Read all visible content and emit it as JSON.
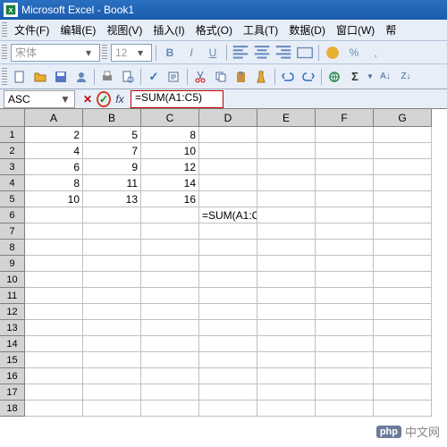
{
  "title": "Microsoft Excel - Book1",
  "menu": {
    "file": "文件(F)",
    "edit": "编辑(E)",
    "view": "视图(V)",
    "insert": "插入(I)",
    "format": "格式(O)",
    "tools": "工具(T)",
    "data": "数据(D)",
    "window": "窗口(W)",
    "help": "帮"
  },
  "format_bar": {
    "font_name": "宋体",
    "font_size": "12"
  },
  "formula_bar": {
    "name_box": "ASC",
    "formula": "=SUM(A1:C5)"
  },
  "columns": [
    "A",
    "B",
    "C",
    "D",
    "E",
    "F",
    "G"
  ],
  "rows": [
    "1",
    "2",
    "3",
    "4",
    "5",
    "6",
    "7",
    "8",
    "9",
    "10",
    "11",
    "12",
    "13",
    "14",
    "15",
    "16",
    "17",
    "18"
  ],
  "chart_data": {
    "type": "table",
    "columns": [
      "A",
      "B",
      "C"
    ],
    "data": [
      [
        2,
        5,
        8
      ],
      [
        4,
        7,
        10
      ],
      [
        6,
        9,
        12
      ],
      [
        8,
        11,
        14
      ],
      [
        10,
        13,
        16
      ]
    ]
  },
  "cells": {
    "A1": "2",
    "B1": "5",
    "C1": "8",
    "A2": "4",
    "B2": "7",
    "C2": "10",
    "A3": "6",
    "B3": "9",
    "C3": "12",
    "A4": "8",
    "B4": "11",
    "C4": "14",
    "A5": "10",
    "B5": "13",
    "C5": "16",
    "D6": "=SUM(A1:C"
  },
  "watermark": "中文网"
}
